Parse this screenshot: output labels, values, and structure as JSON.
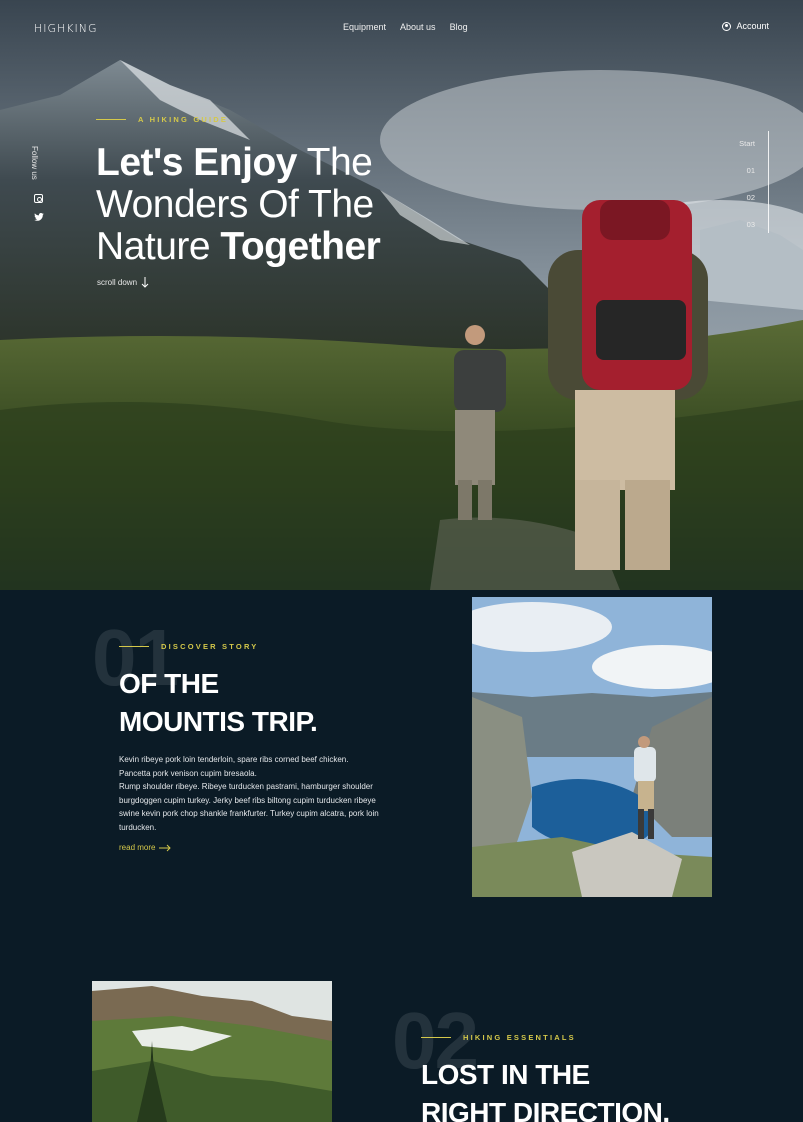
{
  "header": {
    "logo": "HIGHKING",
    "nav": [
      "Equipment",
      "About us",
      "Blog"
    ],
    "account_label": "Account"
  },
  "hero": {
    "eyebrow": "A HIKING GUIDE",
    "title_parts": {
      "line1_bold": "Let's Enjoy",
      "line1_rest": " The",
      "line2": "Wonders Of The",
      "line3_light": "Nature ",
      "line3_bold": "Together"
    },
    "scroll_label": "scroll down",
    "follow_label": "Follow us",
    "social_icons": [
      "instagram-icon",
      "twitter-icon"
    ],
    "slider": [
      "Start",
      "01",
      "02",
      "03"
    ]
  },
  "section1": {
    "number": "01",
    "eyebrow": "DISCOVER STORY",
    "title_line1": "OF THE",
    "title_line2": "MOUNTIS TRIP.",
    "body": "Kevin ribeye pork loin tenderloin, spare ribs corned beef chicken. Pancetta pork venison cupim bresaola.\nRump shoulder ribeye. Ribeye turducken pastrami, hamburger shoulder burgdoggen cupim turkey. Jerky beef ribs biltong cupim turducken ribeye swine kevin pork chop shankle frankfurter. Turkey cupim alcatra, pork loin turducken.",
    "read_more": "read more"
  },
  "section2": {
    "number": "02",
    "eyebrow": "HIKING ESSENTIALS",
    "title_line1": "LOST IN THE",
    "title_line2": "RIGHT DIRECTION."
  },
  "colors": {
    "accent": "#d4c84a",
    "background": "#0b1b26"
  }
}
